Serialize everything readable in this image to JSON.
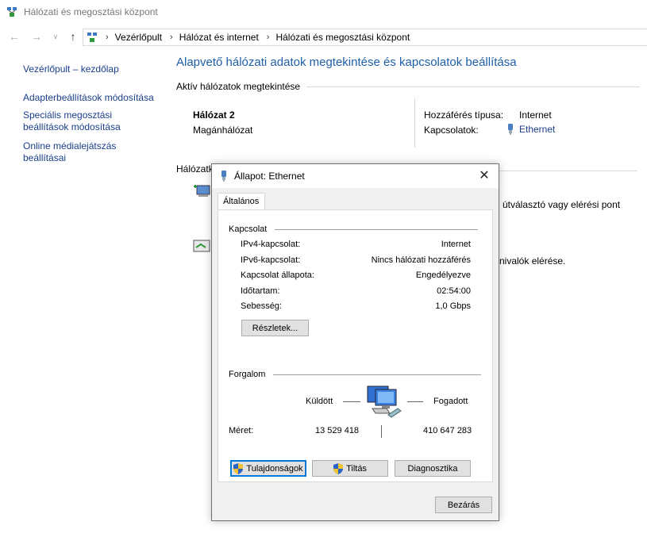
{
  "window": {
    "title": "Hálózati és megosztási központ"
  },
  "address": {
    "crumbs": [
      "Vezérlőpult",
      "Hálózat és internet",
      "Hálózati és megosztási központ"
    ]
  },
  "leftnav": {
    "home": "Vezérlőpult – kezdőlap",
    "adapter": "Adapterbeállítások módosítása",
    "sharing_line1": "Speciális megosztási",
    "sharing_line2": "beállítások módosítása",
    "media_line1": "Online médialejátszás",
    "media_line2": "beállításai"
  },
  "main": {
    "title": "Alapvető hálózati adatok megtekintése és kapcsolatok beállítása",
    "active_section": "Aktív hálózatok megtekintése",
    "network_name": "Hálózat  2",
    "network_type": "Magánhálózat",
    "access_label": "Hozzáférés típusa:",
    "access_value": "Internet",
    "connections_label": "Kapcsolatok:",
    "connections_value": "Ethernet",
    "change_section_partial": "Hálózatk",
    "partial_text1": "útválasztó vagy elérési pont",
    "partial_text2": "nivalók elérése."
  },
  "dialog": {
    "title": "Állapot: Ethernet",
    "tab": "Általános",
    "connection_group": "Kapcsolat",
    "rows": [
      {
        "label": "IPv4-kapcsolat:",
        "value": "Internet"
      },
      {
        "label": "IPv6-kapcsolat:",
        "value": "Nincs hálózati hozzáférés"
      },
      {
        "label": "Kapcsolat állapota:",
        "value": "Engedélyezve"
      },
      {
        "label": "Időtartam:",
        "value": "02:54:00"
      },
      {
        "label": "Sebesség:",
        "value": "1,0 Gbps"
      }
    ],
    "details_button": "Részletek...",
    "traffic_group": "Forgalom",
    "sent_label": "Küldött",
    "received_label": "Fogadott",
    "size_label": "Méret:",
    "sent_value": "13 529 418",
    "received_value": "410 647 283",
    "properties_button": "Tulajdonságok",
    "disable_button": "Tiltás",
    "diagnose_button": "Diagnosztika",
    "close_button": "Bezárás"
  },
  "colors": {
    "link": "#1a3e8c",
    "title_blue": "#1e5fa8",
    "focus_blue": "#0078d7"
  }
}
